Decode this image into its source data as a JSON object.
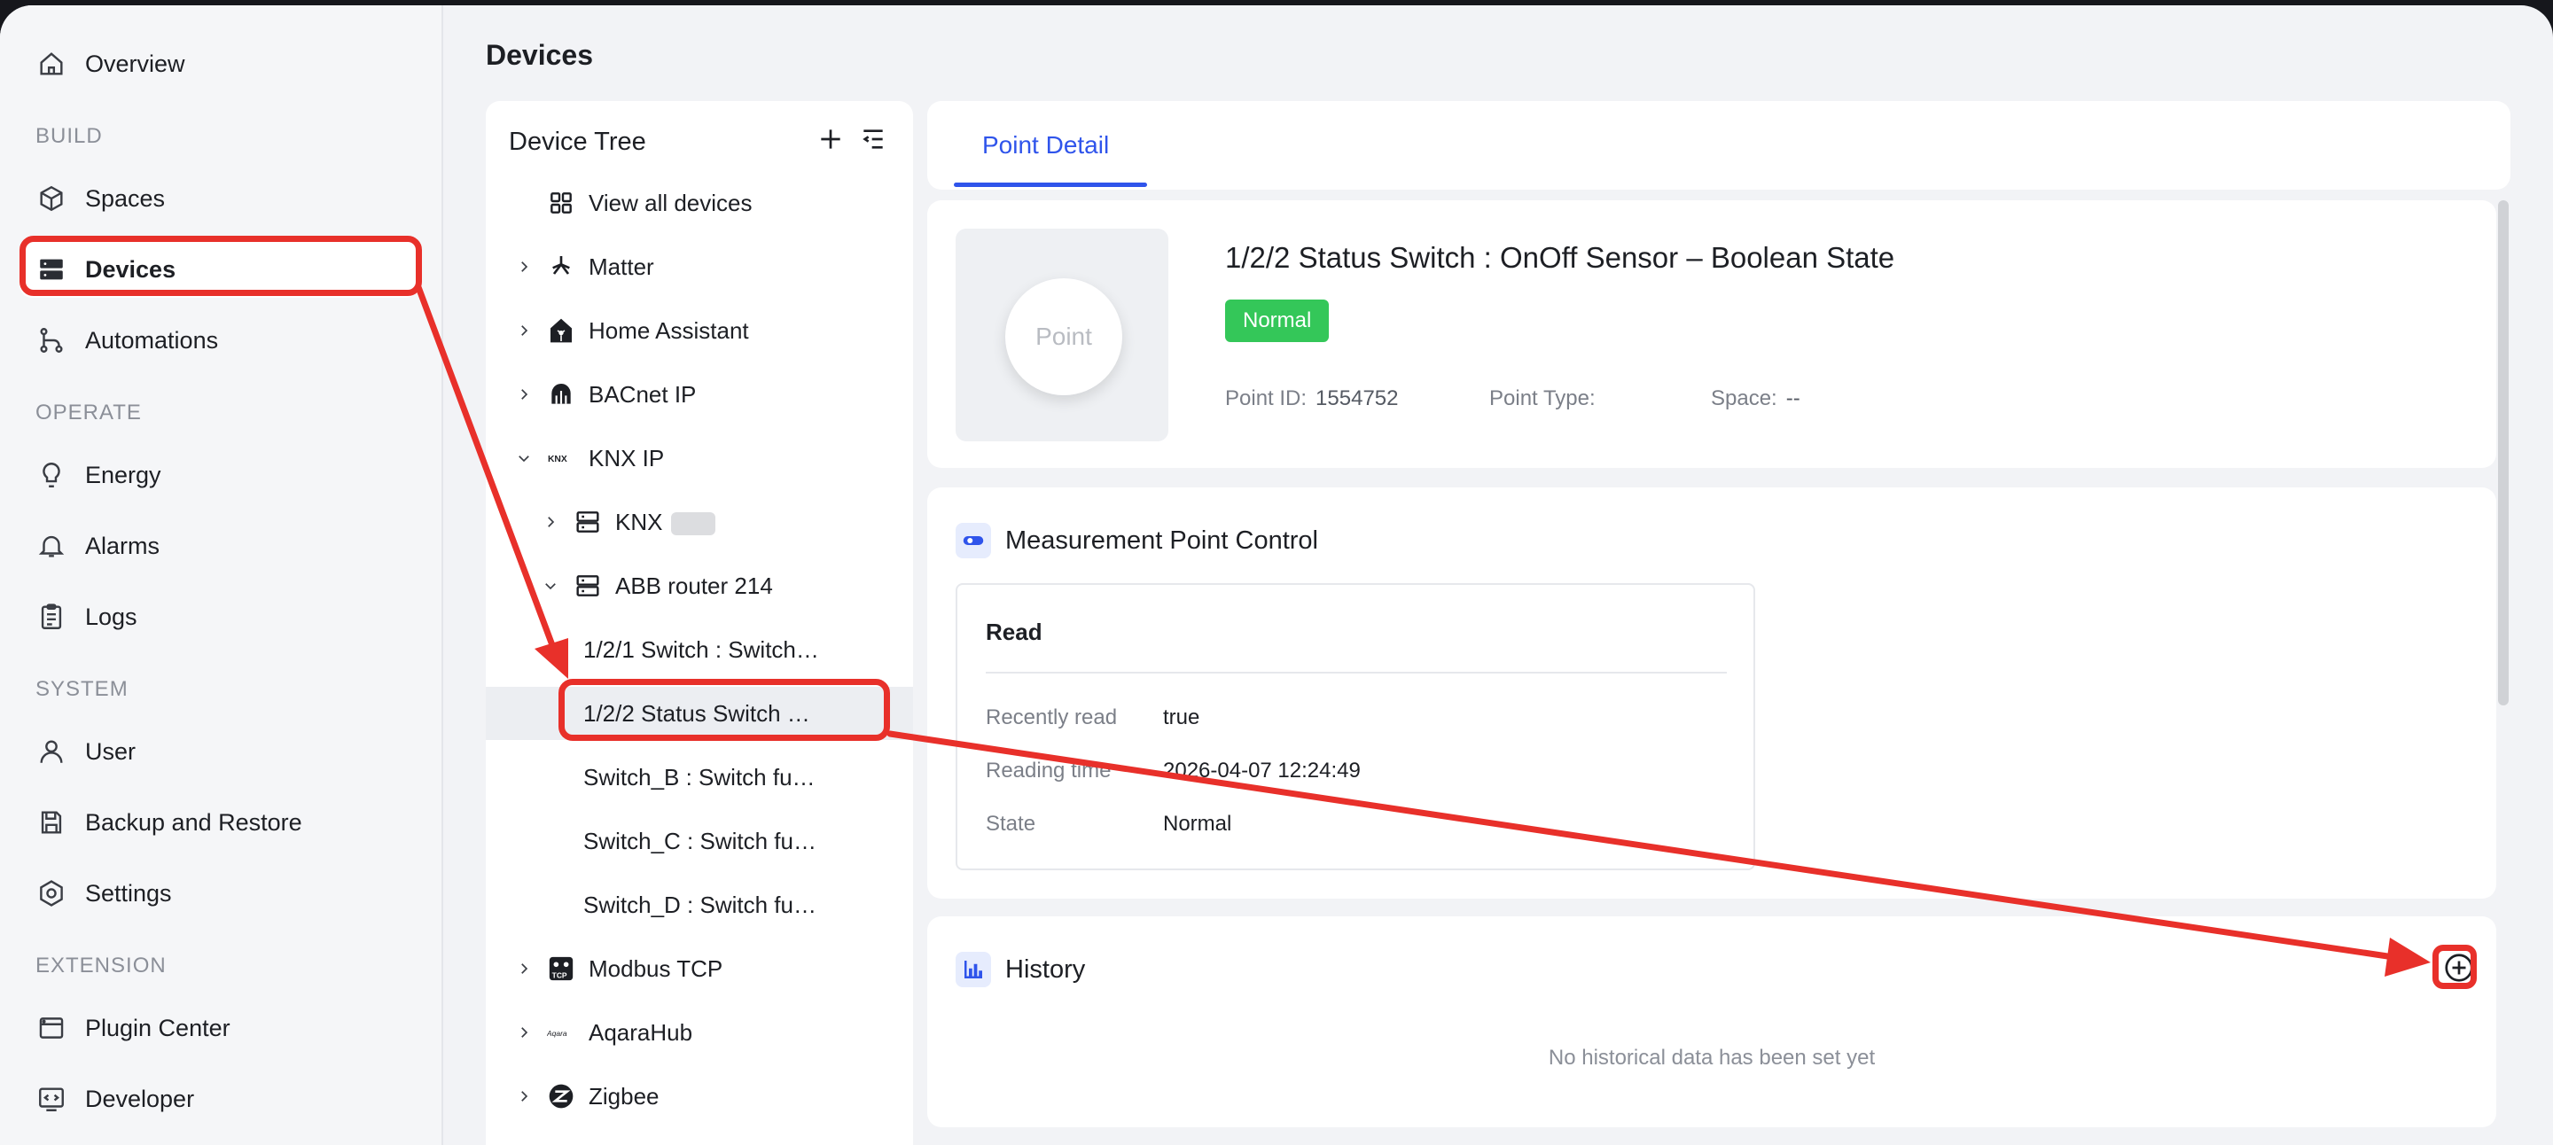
{
  "sidebar": {
    "sections": {
      "build": "BUILD",
      "operate": "OPERATE",
      "system": "SYSTEM",
      "extension": "EXTENSION"
    },
    "items": [
      {
        "label": "Overview",
        "icon": "home-icon"
      },
      {
        "label": "Spaces",
        "icon": "cube-icon"
      },
      {
        "label": "Devices",
        "icon": "server-icon",
        "active": true
      },
      {
        "label": "Automations",
        "icon": "flow-icon"
      },
      {
        "label": "Energy",
        "icon": "bulb-icon"
      },
      {
        "label": "Alarms",
        "icon": "bell-icon"
      },
      {
        "label": "Logs",
        "icon": "clipboard-icon"
      },
      {
        "label": "User",
        "icon": "user-icon"
      },
      {
        "label": "Backup and Restore",
        "icon": "save-icon"
      },
      {
        "label": "Settings",
        "icon": "gear-icon"
      },
      {
        "label": "Plugin Center",
        "icon": "puzzle-icon"
      },
      {
        "label": "Developer",
        "icon": "code-icon"
      }
    ]
  },
  "page": {
    "title": "Devices"
  },
  "tree": {
    "title": "Device Tree",
    "rows": [
      {
        "label": "View all devices"
      },
      {
        "label": "Matter"
      },
      {
        "label": "Home Assistant"
      },
      {
        "label": "BACnet IP"
      },
      {
        "label": "KNX IP"
      },
      {
        "label": "KNX"
      },
      {
        "label": "ABB router 214"
      },
      {
        "label": "1/2/1 Switch : Switch…"
      },
      {
        "label": "1/2/2 Status Switch …"
      },
      {
        "label": "Switch_B : Switch fu…"
      },
      {
        "label": "Switch_C : Switch fu…"
      },
      {
        "label": "Switch_D : Switch fu…"
      },
      {
        "label": "Modbus TCP"
      },
      {
        "label": "AqaraHub"
      },
      {
        "label": "Zigbee"
      }
    ],
    "knx_icon_text": "KNX",
    "aqara_icon_text": "Aqara",
    "modbus_icon_text": "TCP"
  },
  "detail": {
    "tab": "Point Detail",
    "placeholder": "Point",
    "title": "1/2/2 Status Switch : OnOff Sensor – Boolean State",
    "status": "Normal",
    "point_id_label": "Point ID:",
    "point_id": "1554752",
    "point_type_label": "Point Type:",
    "point_type": "",
    "space_label": "Space:",
    "space": "--"
  },
  "control": {
    "title": "Measurement Point Control",
    "read_title": "Read",
    "rows": [
      {
        "key": "Recently read",
        "value": "true"
      },
      {
        "key": "Reading time",
        "value": "2026-04-07 12:24:49"
      },
      {
        "key": "State",
        "value": "Normal"
      }
    ]
  },
  "history": {
    "title": "History",
    "empty": "No historical data has been set yet"
  },
  "colors": {
    "accent": "#2f54eb",
    "success": "#34c759",
    "annotation": "#e8302a"
  }
}
